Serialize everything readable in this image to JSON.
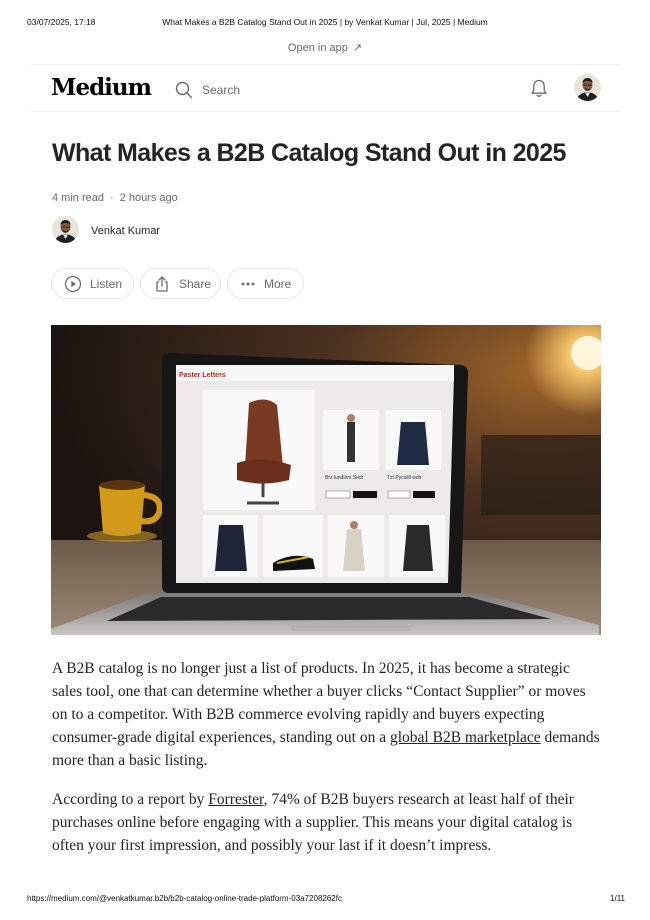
{
  "print_header": {
    "datetime": "03/07/2025, 17:18",
    "title": "What Makes a B2B Catalog Stand Out in 2025 | by Venkat Kumar | Jul, 2025 | Medium"
  },
  "open_app": {
    "label": "Open in app",
    "icon": "arrow-up-right-icon"
  },
  "topbar": {
    "logo": "Medium",
    "search_placeholder": "Search",
    "icons": [
      "search-icon",
      "bell-icon",
      "avatar"
    ]
  },
  "article": {
    "title": "What Makes a B2B Catalog Stand Out in 2025",
    "read_time": "4 min read",
    "separator": "·",
    "published": "2 hours ago",
    "author": "Venkat Kumar",
    "actions": [
      {
        "label": "Listen",
        "icon": "play-circle-icon"
      },
      {
        "label": "Share",
        "icon": "share-icon"
      },
      {
        "label": "More",
        "icon": "more-dots-icon"
      }
    ],
    "hero_image": {
      "laptop_screen_brand": "Paster Letters",
      "product_caption_left": "Brz lundlimr Sndr",
      "product_caption_right": "Tzt Pycoilli wdlr"
    },
    "p1": {
      "before_link": "A B2B catalog is no longer just a list of products. In 2025, it has become a strategic sales tool, one that can determine whether a buyer clicks “Contact Supplier” or moves on to a competitor. With B2B commerce evolving rapidly and buyers expecting consumer-grade digital experiences, standing out on a ",
      "link": "global B2B marketplace",
      "after_link": " demands more than a basic listing."
    },
    "p2": {
      "before_link": "According to a report by ",
      "link": "Forrester",
      "after_link": ", 74% of B2B buyers research at least half of their purchases online before engaging with a supplier. This means your digital catalog is often your first impression, and possibly your last if it doesn’t impress."
    }
  },
  "print_footer": {
    "url": "https://medium.com/@venkatkumar.b2b/b2b-catalog-online-trade-platform-03a7208262fc",
    "page": "1/11"
  },
  "colors": {
    "text": "#242424",
    "muted": "#6b6b6b",
    "border": "#e6e6e6"
  }
}
